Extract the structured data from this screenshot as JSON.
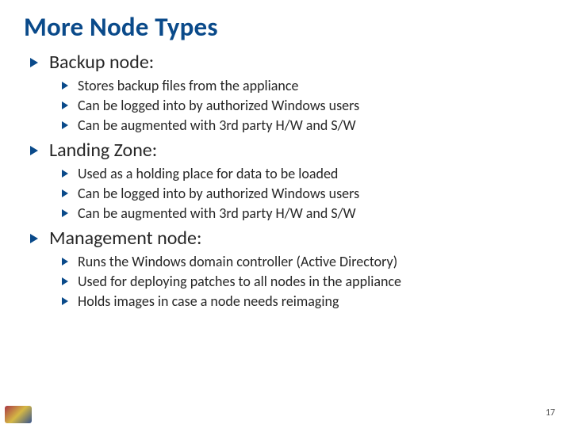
{
  "title": "More Node Types",
  "sections": [
    {
      "heading": "Backup node:",
      "items": [
        "Stores backup files from the appliance",
        "Can be logged into by authorized Windows users",
        "Can be augmented with 3rd party H/W and S/W"
      ]
    },
    {
      "heading": "Landing Zone:",
      "items": [
        "Used as a holding place for data to be loaded",
        "Can be logged into by authorized Windows users",
        "Can be augmented with 3rd party H/W and S/W"
      ]
    },
    {
      "heading": "Management node:",
      "items": [
        "Runs the Windows domain controller (Active Directory)",
        "Used for deploying patches to all nodes in the appliance",
        "Holds images in case a node needs reimaging"
      ]
    }
  ],
  "page_number": "17"
}
